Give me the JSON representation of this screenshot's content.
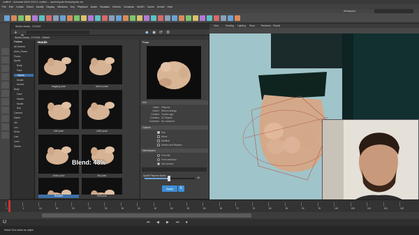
{
  "window": {
    "title": "untitled* - Autodesk MAYA 2023.3: untitled --- Apollo\\Apollo.Ready\\Apollo.ma"
  },
  "menubar": {
    "items": [
      "File",
      "Edit",
      "Create",
      "Select",
      "Modify",
      "Display",
      "Windows",
      "Key",
      "Playback",
      "Audio",
      "Visualize",
      "Deform",
      "Constrain",
      "MASH",
      "Cache",
      "Arnold",
      "Help"
    ]
  },
  "workspace": {
    "label": "Workspace:",
    "value": "Maya Classic"
  },
  "studio": {
    "title": "Studio Library - 2.9.6.b3",
    "tab": "Studio Library - 2.9.6.b3 - Default",
    "breadcrumb": "Poses/Hands",
    "folders_label": "Folders",
    "grid_title": "Hands",
    "blend_label": "Blend: 48%",
    "folders": [
      "All Scenes",
      "Anim_Poses",
      "Poses",
      "Apollo",
      "Body",
      "Face",
      "Hands",
      "Mouth",
      "Aurora",
      "Body",
      "Face",
      "Hands",
      "Mouth",
      "Ava",
      "Camera",
      "Dante",
      "Jet",
      "Leo",
      "Nova",
      "Lisa",
      "Leon",
      "Sasha"
    ],
    "thumbs": [
      {
        "label": "begging pose"
      },
      {
        "label": "clench pose"
      },
      {
        "label": "chill pose"
      },
      {
        "label": "chill2 pose"
      },
      {
        "label": "clinch pose"
      },
      {
        "label": "fist pose"
      },
      {
        "label": "Relaxed"
      },
      {
        "label": "Stiff pose"
      }
    ]
  },
  "pose_panel": {
    "header": "Pose",
    "info_header": "Info",
    "info": [
      {
        "k": "Name",
        "v": "Fistpose"
      },
      {
        "k": "Owner",
        "v": "Ramon Arango"
      },
      {
        "k": "Created",
        "v": "2 years ago"
      },
      {
        "k": "Contains",
        "v": "22 Objects"
      },
      {
        "k": "Comment",
        "v": "No comment"
      }
    ],
    "options_header": "Options",
    "options": [
      "Key",
      "Mirror",
      "Additive",
      "Search and Replace"
    ],
    "namespace_header": "Namespace",
    "namespace_options": [
      "From file",
      "From selection",
      "Use custom"
    ],
    "namespace_value": "Apollo:Fistpose:Apollo",
    "blend_value": "48",
    "apply_label": "Apply"
  },
  "viewport": {
    "menu": [
      "View",
      "Shading",
      "Lighting",
      "Show",
      "Renderer",
      "Panels"
    ]
  },
  "timeline": {
    "ticks": [
      "1",
      "5",
      "10",
      "15",
      "20",
      "25",
      "30",
      "35",
      "40",
      "45",
      "50",
      "55",
      "60",
      "65",
      "70",
      "75",
      "80",
      "85",
      "90",
      "95",
      "100",
      "105",
      "110",
      "115",
      "120"
    ]
  },
  "help": {
    "text": "Select Tool: select an object"
  },
  "chart_data": null
}
